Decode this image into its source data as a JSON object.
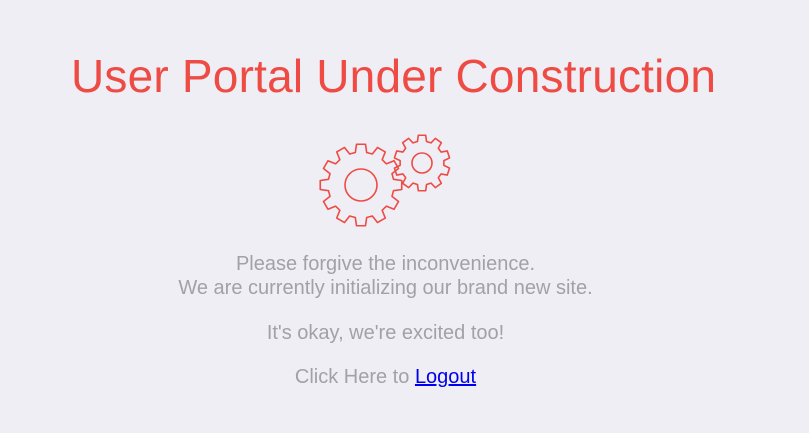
{
  "page": {
    "title": "User Portal Under Construction",
    "gear_icon": "gears-icon",
    "apology_line": "Please forgive the inconvenience.",
    "status_line": "We are currently initializing our brand new site.",
    "excited_line": "It's okay, we're excited too!",
    "logout_prefix": "Click Here to",
    "logout_link": "Logout"
  },
  "colors": {
    "background": "#efeef4",
    "accent": "#ee4b45",
    "text": "#a2a1a7",
    "link": "#0000ee"
  }
}
